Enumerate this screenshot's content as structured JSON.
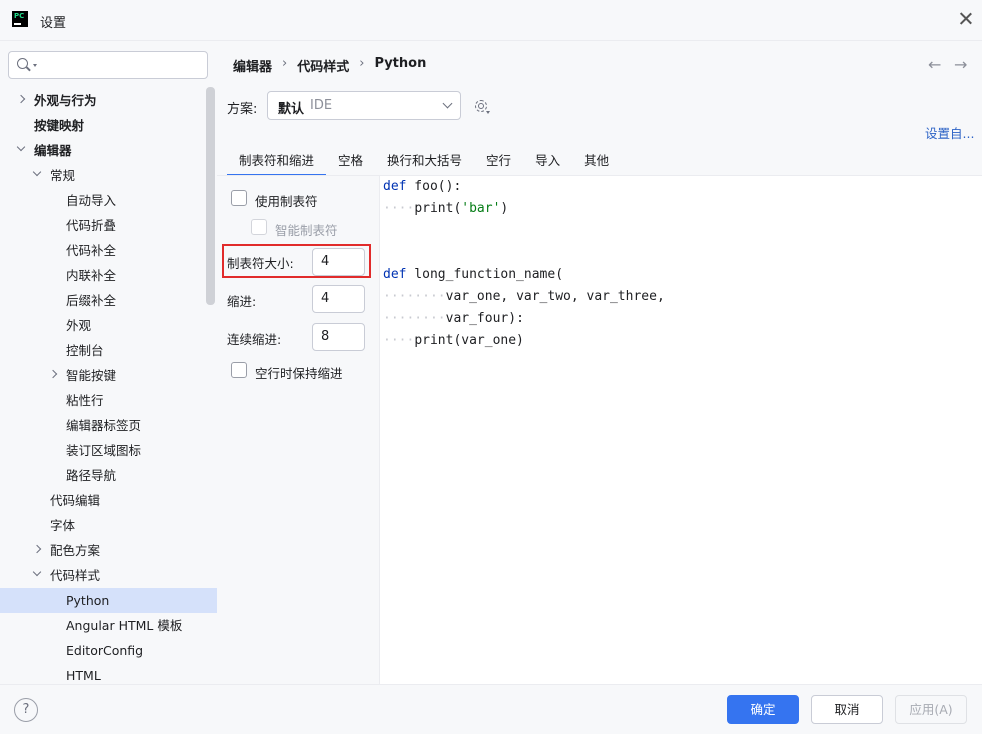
{
  "window": {
    "title": "设置",
    "app_icon_text": "PC"
  },
  "search": {
    "placeholder": "",
    "value": ""
  },
  "tree": [
    {
      "label": "外观与行为",
      "level": 0,
      "bold": true,
      "expander": "right"
    },
    {
      "label": "按键映射",
      "level": 0,
      "bold": true,
      "expander": ""
    },
    {
      "label": "编辑器",
      "level": 0,
      "bold": true,
      "expander": "down"
    },
    {
      "label": "常规",
      "level": 1,
      "bold": false,
      "expander": "down"
    },
    {
      "label": "自动导入",
      "level": 2,
      "bold": false,
      "expander": ""
    },
    {
      "label": "代码折叠",
      "level": 2,
      "bold": false,
      "expander": ""
    },
    {
      "label": "代码补全",
      "level": 2,
      "bold": false,
      "expander": ""
    },
    {
      "label": "内联补全",
      "level": 2,
      "bold": false,
      "expander": ""
    },
    {
      "label": "后缀补全",
      "level": 2,
      "bold": false,
      "expander": ""
    },
    {
      "label": "外观",
      "level": 2,
      "bold": false,
      "expander": ""
    },
    {
      "label": "控制台",
      "level": 2,
      "bold": false,
      "expander": ""
    },
    {
      "label": "智能按键",
      "level": 2,
      "bold": false,
      "expander": "right"
    },
    {
      "label": "粘性行",
      "level": 2,
      "bold": false,
      "expander": ""
    },
    {
      "label": "编辑器标签页",
      "level": 2,
      "bold": false,
      "expander": ""
    },
    {
      "label": "装订区域图标",
      "level": 2,
      "bold": false,
      "expander": ""
    },
    {
      "label": "路径导航",
      "level": 2,
      "bold": false,
      "expander": ""
    },
    {
      "label": "代码编辑",
      "level": 1,
      "bold": false,
      "expander": ""
    },
    {
      "label": "字体",
      "level": 1,
      "bold": false,
      "expander": ""
    },
    {
      "label": "配色方案",
      "level": 1,
      "bold": false,
      "expander": "right"
    },
    {
      "label": "代码样式",
      "level": 1,
      "bold": false,
      "expander": "down"
    },
    {
      "label": "Python",
      "level": 2,
      "bold": false,
      "expander": "",
      "selected": true
    },
    {
      "label": "Angular HTML 模板",
      "level": 2,
      "bold": false,
      "expander": ""
    },
    {
      "label": "EditorConfig",
      "level": 2,
      "bold": false,
      "expander": ""
    },
    {
      "label": "HTML",
      "level": 2,
      "bold": false,
      "expander": ""
    }
  ],
  "breadcrumb": {
    "items": [
      "编辑器",
      "代码样式",
      "Python"
    ],
    "separator": "›"
  },
  "nav": {
    "back": "←",
    "forward": "→"
  },
  "scheme": {
    "label": "方案:",
    "name": "默认",
    "scope": "IDE"
  },
  "settings_link": "设置自...",
  "tabs": [
    "制表符和缩进",
    "空格",
    "换行和大括号",
    "空行",
    "导入",
    "其他"
  ],
  "options": {
    "use_tab": {
      "label": "使用制表符",
      "checked": false
    },
    "smart_tab": {
      "label": "智能制表符",
      "checked": false,
      "disabled": true
    },
    "tab_size": {
      "label": "制表符大小:",
      "value": "4"
    },
    "indent": {
      "label": "缩进:",
      "value": "4"
    },
    "continuation_indent": {
      "label": "连续缩进:",
      "value": "8"
    },
    "keep_indent_on_empty": {
      "label": "空行时保持缩进",
      "checked": false
    }
  },
  "code": {
    "line1_kw": "def",
    "line1_rest": " foo():",
    "line2_dots": "····",
    "line2_fn": "print(",
    "line2_str": "'bar'",
    "line2_end": ")",
    "line5_kw": "def",
    "line5_rest": " long_function_name(",
    "line6_dots": "········",
    "line6_text": "var_one, var_two, var_three,",
    "line7_dots": "········",
    "line7_text": "var_four):",
    "line8_dots": "····",
    "line8_text": "print(var_one)"
  },
  "footer": {
    "help": "?",
    "ok": "确定",
    "cancel": "取消",
    "apply": "应用(A)"
  },
  "colors": {
    "accent": "#3574f0",
    "selection": "#d5e1fa",
    "highlight": "#e12b2b",
    "keyword": "#0033b3",
    "string": "#067d17"
  }
}
